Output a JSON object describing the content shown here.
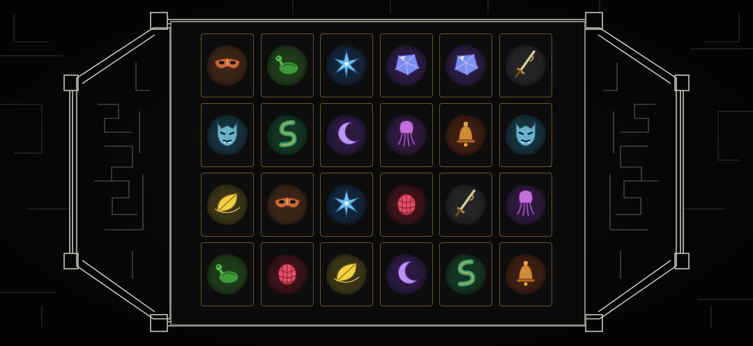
{
  "board": {
    "rows": 4,
    "cols": 6,
    "tiles": [
      {
        "item": "mask",
        "blob": "#3a2418"
      },
      {
        "item": "turtle",
        "blob": "#1f3a1a"
      },
      {
        "item": "star",
        "blob": "#142438"
      },
      {
        "item": "gem",
        "blob": "#2a1c3e"
      },
      {
        "item": "gem",
        "blob": "#2a1c3e"
      },
      {
        "item": "dagger",
        "blob": "#242424"
      },
      {
        "item": "demon-mask",
        "blob": "#17303a"
      },
      {
        "item": "jade-s",
        "blob": "#143421"
      },
      {
        "item": "moon",
        "blob": "#2a1a3e"
      },
      {
        "item": "squid",
        "blob": "#2c1a3a"
      },
      {
        "item": "bell",
        "blob": "#3a1e12"
      },
      {
        "item": "demon-mask",
        "blob": "#17303a"
      },
      {
        "item": "leaf",
        "blob": "#3a3416"
      },
      {
        "item": "mask",
        "blob": "#3a2418"
      },
      {
        "item": "star",
        "blob": "#142438"
      },
      {
        "item": "pinecone",
        "blob": "#3a1418"
      },
      {
        "item": "dagger",
        "blob": "#242424"
      },
      {
        "item": "squid",
        "blob": "#2c1a3a"
      },
      {
        "item": "turtle",
        "blob": "#1f3a1a"
      },
      {
        "item": "pinecone",
        "blob": "#3a1418"
      },
      {
        "item": "leaf",
        "blob": "#3a3416"
      },
      {
        "item": "moon",
        "blob": "#2a1a3e"
      },
      {
        "item": "jade-s",
        "blob": "#143421"
      },
      {
        "item": "bell",
        "blob": "#3a1e12"
      }
    ]
  },
  "colors": {
    "frame_line": "#bdbdb0",
    "tile_border": "#6e5320",
    "background": "#050505"
  }
}
